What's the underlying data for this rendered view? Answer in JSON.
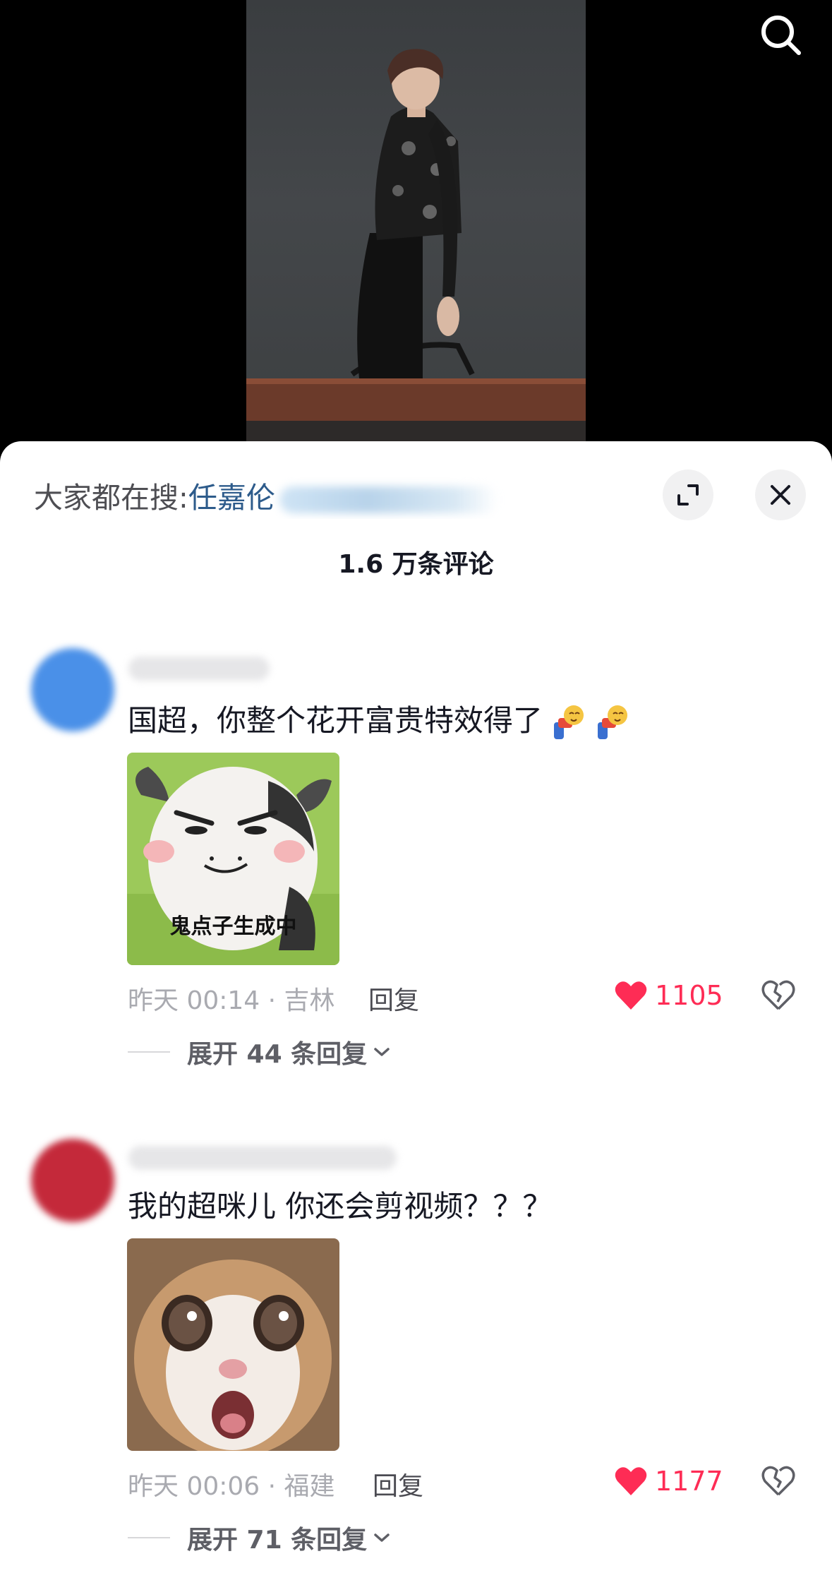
{
  "search": {
    "icon": "search-icon"
  },
  "trending": {
    "prefix": "大家都在搜:",
    "keyword": "任嘉伦"
  },
  "sheet": {
    "comment_count": "1.6 万条评论"
  },
  "comments": [
    {
      "text": "国超，你整个花开富贵特效得了",
      "sticker_caption": "鬼点子生成中",
      "time_location": "昨天 00:14 · 吉林",
      "reply_label": "回复",
      "like_count": "1105",
      "expand_label": "展开 44 条回复",
      "avatar_color": "#4a90e8"
    },
    {
      "text": "我的超咪儿 你还会剪视频？？？",
      "time_location": "昨天 00:06 · 福建",
      "reply_label": "回复",
      "like_count": "1177",
      "expand_label": "展开 71 条回复",
      "avatar_color": "#c4293a"
    }
  ],
  "colors": {
    "like": "#fe2c55",
    "keyword": "#2d5b8b"
  }
}
